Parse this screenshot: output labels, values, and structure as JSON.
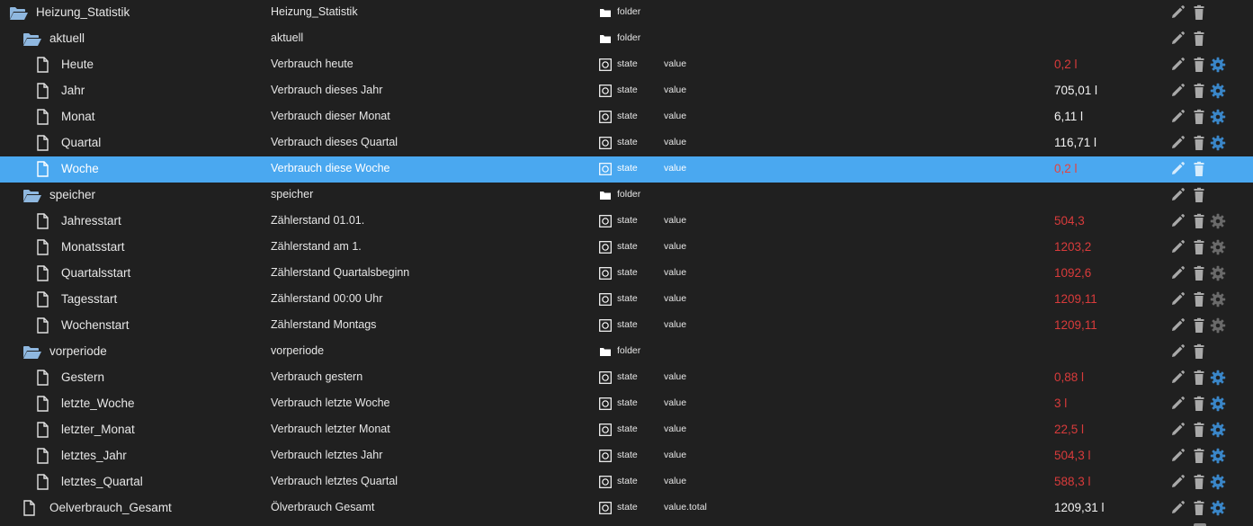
{
  "colors": {
    "background": "#202020",
    "selected_row": "#4aa8f0",
    "value_red": "#d93b3b",
    "folder_icon": "#8fb8e0",
    "gear_active": "#3a86c8",
    "gear_inactive": "#6a6a6a",
    "action_icon": "#a9a9a9"
  },
  "rows": [
    {
      "label": "Heizung_Statistik",
      "name": "Heizung_Statistik",
      "type": "folder",
      "role": "",
      "value": "",
      "icon": "folder-open-icon",
      "level": 0,
      "gear": "none",
      "val_color": "",
      "selected": false
    },
    {
      "label": "aktuell",
      "name": "aktuell",
      "type": "folder",
      "role": "",
      "value": "",
      "icon": "folder-open-icon",
      "level": 1,
      "gear": "none",
      "val_color": "",
      "selected": false
    },
    {
      "label": "Heute",
      "name": "Verbrauch heute",
      "type": "state",
      "role": "value",
      "value": "0,2 l",
      "icon": "file-icon",
      "level": 2,
      "gear": "active",
      "val_color": "red",
      "selected": false
    },
    {
      "label": "Jahr",
      "name": "Verbrauch dieses Jahr",
      "type": "state",
      "role": "value",
      "value": "705,01 l",
      "icon": "file-icon",
      "level": 2,
      "gear": "active",
      "val_color": "white",
      "selected": false
    },
    {
      "label": "Monat",
      "name": "Verbrauch dieser Monat",
      "type": "state",
      "role": "value",
      "value": "6,11 l",
      "icon": "file-icon",
      "level": 2,
      "gear": "active",
      "val_color": "white",
      "selected": false
    },
    {
      "label": "Quartal",
      "name": "Verbrauch dieses Quartal",
      "type": "state",
      "role": "value",
      "value": "116,71 l",
      "icon": "file-icon",
      "level": 2,
      "gear": "active",
      "val_color": "white",
      "selected": false
    },
    {
      "label": "Woche",
      "name": "Verbrauch diese Woche",
      "type": "state",
      "role": "value",
      "value": "0,2 l",
      "icon": "file-icon",
      "level": 2,
      "gear": "none",
      "val_color": "red",
      "selected": true
    },
    {
      "label": "speicher",
      "name": "speicher",
      "type": "folder",
      "role": "",
      "value": "",
      "icon": "folder-open-icon",
      "level": 1,
      "gear": "none",
      "val_color": "",
      "selected": false
    },
    {
      "label": "Jahresstart",
      "name": "Zählerstand 01.01.",
      "type": "state",
      "role": "value",
      "value": "504,3",
      "icon": "file-icon",
      "level": 2,
      "gear": "inactive",
      "val_color": "red",
      "selected": false
    },
    {
      "label": "Monatsstart",
      "name": "Zählerstand am 1.",
      "type": "state",
      "role": "value",
      "value": "1203,2",
      "icon": "file-icon",
      "level": 2,
      "gear": "inactive",
      "val_color": "red",
      "selected": false
    },
    {
      "label": "Quartalsstart",
      "name": "Zählerstand Quartalsbeginn",
      "type": "state",
      "role": "value",
      "value": "1092,6",
      "icon": "file-icon",
      "level": 2,
      "gear": "inactive",
      "val_color": "red",
      "selected": false
    },
    {
      "label": "Tagesstart",
      "name": "Zählerstand 00:00 Uhr",
      "type": "state",
      "role": "value",
      "value": "1209,11",
      "icon": "file-icon",
      "level": 2,
      "gear": "inactive",
      "val_color": "red",
      "selected": false
    },
    {
      "label": "Wochenstart",
      "name": "Zählerstand Montags",
      "type": "state",
      "role": "value",
      "value": "1209,11",
      "icon": "file-icon",
      "level": 2,
      "gear": "inactive",
      "val_color": "red",
      "selected": false
    },
    {
      "label": "vorperiode",
      "name": "vorperiode",
      "type": "folder",
      "role": "",
      "value": "",
      "icon": "folder-open-icon",
      "level": 1,
      "gear": "none",
      "val_color": "",
      "selected": false
    },
    {
      "label": "Gestern",
      "name": "Verbrauch gestern",
      "type": "state",
      "role": "value",
      "value": "0,88 l",
      "icon": "file-icon",
      "level": 2,
      "gear": "active",
      "val_color": "red",
      "selected": false
    },
    {
      "label": "letzte_Woche",
      "name": "Verbrauch letzte Woche",
      "type": "state",
      "role": "value",
      "value": "3 l",
      "icon": "file-icon",
      "level": 2,
      "gear": "active",
      "val_color": "red",
      "selected": false
    },
    {
      "label": "letzter_Monat",
      "name": "Verbrauch letzter Monat",
      "type": "state",
      "role": "value",
      "value": "22,5 l",
      "icon": "file-icon",
      "level": 2,
      "gear": "active",
      "val_color": "red",
      "selected": false
    },
    {
      "label": "letztes_Jahr",
      "name": "Verbrauch letztes Jahr",
      "type": "state",
      "role": "value",
      "value": "504,3 l",
      "icon": "file-icon",
      "level": 2,
      "gear": "active",
      "val_color": "red",
      "selected": false
    },
    {
      "label": "letztes_Quartal",
      "name": "Verbrauch letztes Quartal",
      "type": "state",
      "role": "value",
      "value": "588,3 l",
      "icon": "file-icon",
      "level": 2,
      "gear": "active",
      "val_color": "red",
      "selected": false
    },
    {
      "label": "Oelverbrauch_Gesamt",
      "name": "Ölverbrauch Gesamt",
      "type": "state",
      "role": "value.total",
      "value": "1209,31 l",
      "icon": "file-icon",
      "level": 1,
      "gear": "active",
      "val_color": "white",
      "selected": false
    }
  ]
}
